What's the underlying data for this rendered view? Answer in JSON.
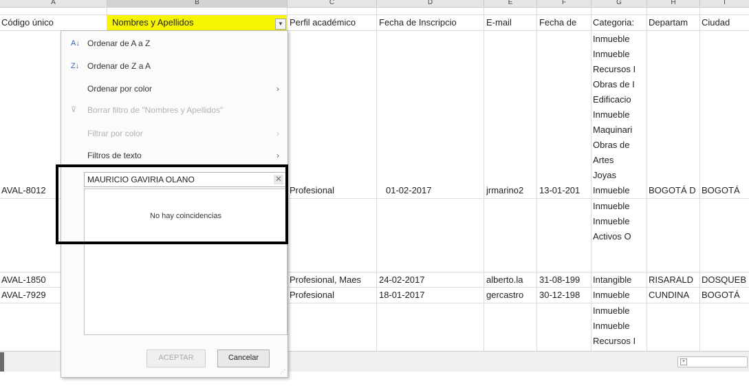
{
  "column_letters": [
    "A",
    "B",
    "C",
    "D",
    "E",
    "F",
    "G",
    "H",
    "I"
  ],
  "headers": {
    "codigo": "Código único",
    "nombres": "Nombres y Apellidos",
    "perfil": "Perfil académico",
    "fecha_inscripcion": "Fecha de Inscripcio",
    "email": "E-mail",
    "fecha_nac": "Fecha de",
    "categoria": "Categoria:",
    "departamento": "Departam",
    "ciudad": "Ciudad"
  },
  "rows": {
    "categoria_col": [
      "Inmueble",
      "Inmueble",
      "Recursos I",
      "Obras de I",
      "Edificacio",
      "Inmueble",
      "Maquinari",
      "Obras de",
      "Artes",
      "Joyas",
      "Inmueble",
      "Inmueble",
      "Inmueble",
      "Activos O",
      "Intangible",
      "Inmueble",
      "Inmueble",
      "Inmueble",
      "Recursos I"
    ],
    "r10": {
      "codigo": "AVAL-8012",
      "perfil": "Profesional",
      "fecha": "01-02-2017",
      "email": "jrmarino2",
      "fnac": "13-01-201",
      "dep": "BOGOTÁ D",
      "ciudad": "BOGOTÁ"
    },
    "r15": {
      "codigo": "AVAL-1850",
      "perfil": "Profesional, Maes",
      "fecha": "24-02-2017",
      "email": "alberto.la",
      "fnac": "31-08-199",
      "dep": "RISARALD",
      "ciudad": "DOSQUEB"
    },
    "r16": {
      "codigo": "AVAL-7929",
      "perfil": "Profesional",
      "fecha": "18-01-2017",
      "email": "gercastro",
      "fnac": "30-12-198",
      "dep": "CUNDINA",
      "ciudad": "BOGOTÁ"
    }
  },
  "filter_menu": {
    "sort_az": "Ordenar de A a Z",
    "sort_za": "Ordenar de Z a A",
    "sort_color": "Ordenar por color",
    "clear_filter": "Borrar filtro de \"Nombres y Apellidos\"",
    "filter_color": "Filtrar por color",
    "text_filters": "Filtros de texto",
    "search_value": "MAURICIO GAVIRIA OLANO",
    "no_matches": "No hay coincidencias",
    "ok_button": "ACEPTAR",
    "cancel_button": "Cancelar"
  },
  "colors": {
    "header_highlight": "#f7f500",
    "callout_border": "#000000",
    "sort_icon": "#2b62b0"
  }
}
